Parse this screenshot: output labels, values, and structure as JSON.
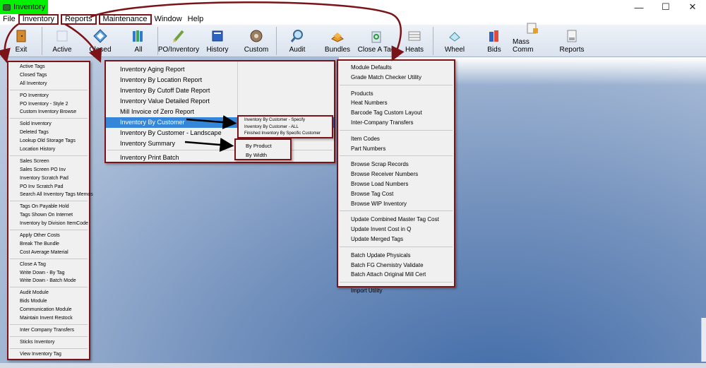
{
  "window": {
    "title": "Inventory",
    "controls": [
      "—",
      "☐",
      "✕"
    ]
  },
  "menubar": [
    "File",
    "Inventory",
    "Reports",
    "Maintenance",
    "Window",
    "Help"
  ],
  "toolbar": [
    {
      "label": "Exit",
      "icon": "exit-door-icon"
    },
    {
      "label": "Active",
      "icon": "active-tag-icon"
    },
    {
      "label": "Closed",
      "icon": "closed-tag-icon"
    },
    {
      "label": "All",
      "icon": "all-books-icon"
    },
    {
      "label": "PO/Inventory",
      "icon": "pencil-icon"
    },
    {
      "label": "History",
      "icon": "history-book-icon"
    },
    {
      "label": "Custom",
      "icon": "custom-coil-icon"
    },
    {
      "label": "Audit",
      "icon": "magnifier-icon"
    },
    {
      "label": "Bundles",
      "icon": "bundles-icon"
    },
    {
      "label": "Close A Tag",
      "icon": "recycle-bin-icon"
    },
    {
      "label": "Heats",
      "icon": "heats-table-icon"
    },
    {
      "label": "Wheel",
      "icon": "wheel-icon"
    },
    {
      "label": "Bids",
      "icon": "bids-books-icon"
    },
    {
      "label": "Mass Comm",
      "icon": "mass-comm-icon"
    },
    {
      "label": "Reports",
      "icon": "reports-printer-icon"
    }
  ],
  "inventory_menu": [
    [
      "Active Tags",
      "Closed Tags",
      "All Inventory"
    ],
    [
      "PO Inventory",
      "PO Inventory - Style 2",
      "Custom Inventory Browse"
    ],
    [
      "Sold Inventory",
      "Deleted Tags",
      "Lookup Old Storage Tags",
      "Location History"
    ],
    [
      "Sales Screen",
      "Sales Screen PO Inv",
      "Inventory Scratch Pad",
      "PO Inv Scratch Pad",
      "Search All Inventory Tags Memos"
    ],
    [
      "Tags On Payable Hold",
      "Tags Shown On Internet",
      "Inventory by Division ItemCode"
    ],
    [
      "Apply Other Costs",
      "Break The Bundle",
      "Cost Average Material"
    ],
    [
      "Close A Tag",
      "Write Down - By Tag",
      "Write Down - Batch Mode"
    ],
    [
      "Audit Module",
      "Bids Module",
      "Communication Module",
      "Maintain Invent Restock"
    ],
    [
      "Inter Company Transfers"
    ],
    [
      "Sticks Inventory"
    ],
    [
      "View Inventory Tag"
    ]
  ],
  "reports_menu": {
    "items": [
      "Inventory Aging Report",
      "Inventory By Location Report",
      "Inventory By Cutoff Date Report",
      "Inventory Value Detailed Report",
      "Mill Invoice of Zero Report",
      "Inventory By Customer",
      "Inventory By Customer - Landscape"
    ],
    "summary": "Inventory Summary",
    "last": "Inventory Print Batch",
    "active_index": 5
  },
  "customer_submenu": [
    "Inventory By Customer  -  Specify",
    "Inventory By Customer  -  ALL",
    "Finished Inventory By Specific Customer"
  ],
  "summary_submenu": [
    "By Product",
    "By Width"
  ],
  "maintenance_menu": [
    [
      "Module Defaults",
      "Grade Match Checker Utility"
    ],
    [
      "Products",
      "Heat Numbers",
      "Barcode Tag Custom Layout",
      "Inter-Company Transfers"
    ],
    [
      "Item Codes",
      "Part Numbers"
    ],
    [
      "Browse Scrap Records",
      "Browse Receiver Numbers",
      "Browse Load Numbers",
      "Browse Tag Cost",
      "Browse WIP Inventory"
    ],
    [
      "Update Combined Master Tag Cost",
      "Update Invent Cost in Q",
      "Update Merged Tags"
    ],
    [
      "Batch Update Physicals",
      "Batch FG Chemistry Validate",
      "Batch Attach Original Mill Cert"
    ],
    [
      "Import Utility"
    ]
  ],
  "colors": {
    "annotation": "#7a1418",
    "title_highlight": "#00f000",
    "menu_selected": "#3585d8"
  }
}
